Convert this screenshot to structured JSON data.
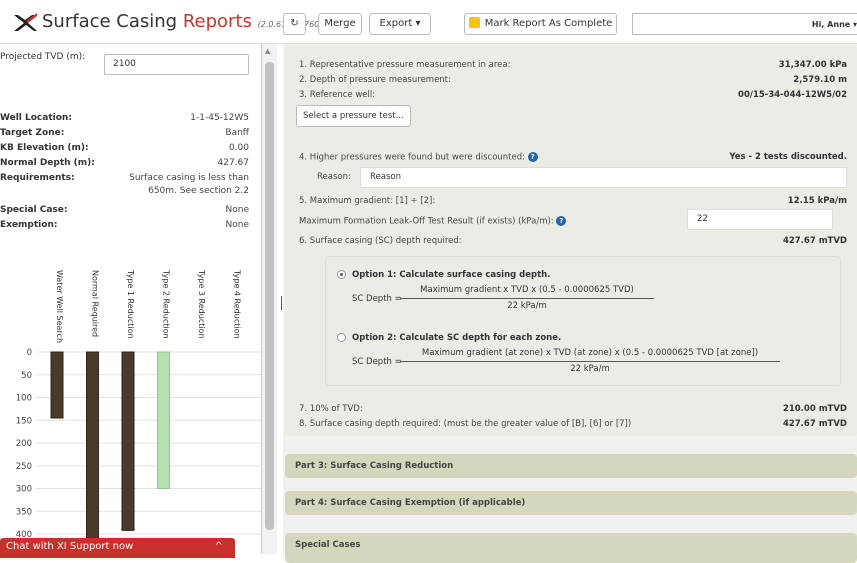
{
  "header": {
    "title_a": "Surface Casing",
    "title_b": "Reports",
    "version": "(2.0.6136.17602)",
    "refresh_icon": "↻",
    "merge_label": "Merge",
    "export_label": "Export ▾",
    "complete_label": "Mark Report As Complete",
    "user_label": "Hi, Anne ▾"
  },
  "left": {
    "tvd_label": "Projected TVD (m):",
    "tvd_value": "2100",
    "rows": [
      {
        "label": "Well Location:",
        "value": "1-1-45-12W5"
      },
      {
        "label": "Target Zone:",
        "value": "Banff"
      },
      {
        "label": "KB Elevation (m):",
        "value": "0.00"
      },
      {
        "label": "Normal Depth (m):",
        "value": "427.67"
      }
    ],
    "req_label": "Requirements:",
    "req_line1": "Surface casing is less than",
    "req_line2": "650m. See section 2.2",
    "special_label": "Special Case:",
    "special_value": "None",
    "exempt_label": "Exemption:",
    "exempt_value": "None",
    "chat_label": "Chat with XI Support now",
    "chat_icon": "^"
  },
  "chart_data": {
    "type": "bar",
    "categories": [
      "Water Well Search",
      "Normal Required",
      "Type 1 Reduction",
      "Type 2 Reduction",
      "Type 3 Reduction",
      "Type 4 Reduction"
    ],
    "values": [
      145,
      415,
      392,
      300,
      null,
      null
    ],
    "colors": [
      "#4a3a2a",
      "#4a3a2a",
      "#4a3a2a",
      "#b5e0b0",
      null,
      null
    ],
    "yticks": [
      0,
      50,
      100,
      150,
      200,
      250,
      300,
      350,
      400
    ],
    "ylim": [
      0,
      420
    ],
    "inverted": true,
    "grid": true
  },
  "part2": {
    "r1": "1. Representative pressure measurement in area:",
    "v1": "31,347.00 kPa",
    "r2": "2. Depth of pressure measurement:",
    "v2": "2,579.10 m",
    "r3": "3. Reference well:",
    "v3": "00/15-34-044-12W5/02",
    "select_btn": "Select a pressure test...",
    "r4": "4. Higher pressures were found but were discounted:",
    "v4": "Yes - 2 tests discounted.",
    "reason_label": "Reason:",
    "reason_value": "Reason",
    "r5": "5. Maximum gradient: [1] ÷ [2]:",
    "v5": "12.15 kPa/m",
    "r_leak": "Maximum Formation Leak-Off Test Result (if exists) (kPa/m):",
    "leak_value": "22",
    "r6": "6. Surface casing (SC) depth required:",
    "v6": "427.67 mTVD",
    "opt1_title": "Option 1: Calculate surface casing depth.",
    "opt1_lhs": "SC Depth =",
    "opt1_num": "Maximum gradient x TVD x (0.5 - 0.0000625 TVD)",
    "opt1_den": "22 kPa/m",
    "opt2_title": "Option 2: Calculate SC depth for each zone.",
    "opt2_lhs": "SC Depth =",
    "opt2_num": "Maximum gradient (at zone) x TVD (at zone) x (0.5 - 0.0000625 TVD [at zone])",
    "opt2_den": "22 kPa/m",
    "r7": "7. 10% of TVD:",
    "v7": "210.00 mTVD",
    "r8": "8. Surface casing depth required: (must be the greater value of [B], [6] or [7])",
    "v8": "427.67 mTVD",
    "help_icon": "?"
  },
  "sections": {
    "part3": "Part 3: Surface Casing Reduction",
    "part4": "Part 4: Surface Casing Exemption (if applicable)",
    "special": "Special Cases"
  }
}
